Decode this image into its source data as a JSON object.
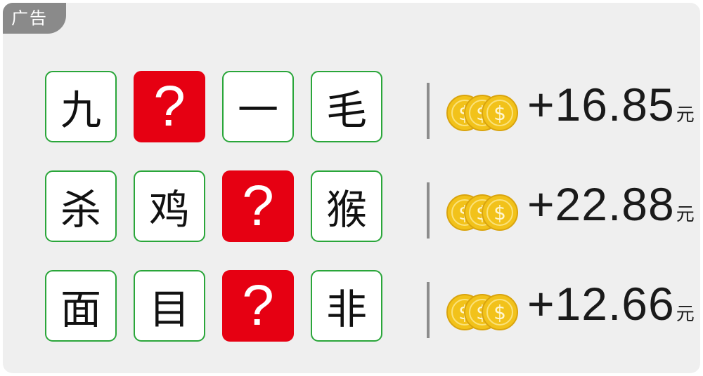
{
  "ad_tag": "广告",
  "colors": {
    "tile_border": "#2aa63a",
    "question_tile": "#e60012",
    "coin": "#f2c21a",
    "card_bg": "#efefef"
  },
  "rows": [
    {
      "tiles": [
        {
          "text": "九",
          "is_question": false
        },
        {
          "text": "?",
          "is_question": true
        },
        {
          "text": "一",
          "is_question": false
        },
        {
          "text": "毛",
          "is_question": false
        }
      ],
      "coin_icon": "gold-coins-icon",
      "amount": "+16.85",
      "unit": "元"
    },
    {
      "tiles": [
        {
          "text": "杀",
          "is_question": false
        },
        {
          "text": "鸡",
          "is_question": false
        },
        {
          "text": "?",
          "is_question": true
        },
        {
          "text": "猴",
          "is_question": false
        }
      ],
      "coin_icon": "gold-coins-icon",
      "amount": "+22.88",
      "unit": "元"
    },
    {
      "tiles": [
        {
          "text": "面",
          "is_question": false
        },
        {
          "text": "目",
          "is_question": false
        },
        {
          "text": "?",
          "is_question": true
        },
        {
          "text": "非",
          "is_question": false
        }
      ],
      "coin_icon": "gold-coins-icon",
      "amount": "+12.66",
      "unit": "元"
    }
  ]
}
